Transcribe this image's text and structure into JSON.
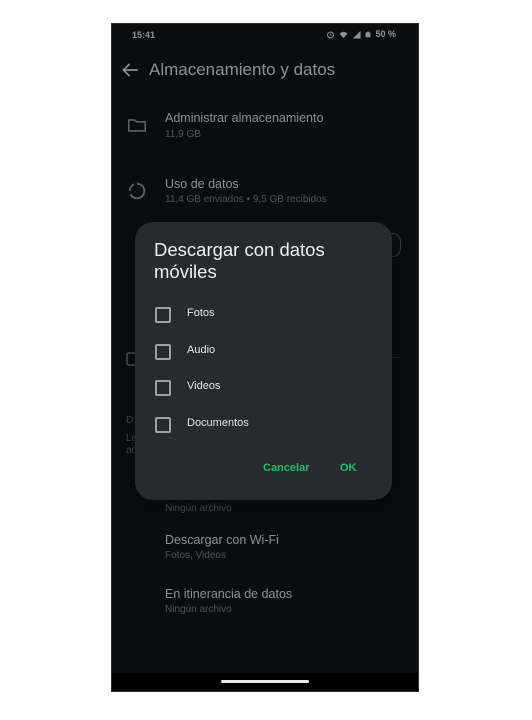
{
  "status_bar": {
    "time": "15:41",
    "battery": "50 %",
    "icons": [
      "alarm-icon",
      "wifi-icon",
      "signal-icon",
      "battery-icon"
    ]
  },
  "app_bar": {
    "title": "Almacenamiento y datos"
  },
  "settings": {
    "manage_storage": {
      "title": "Administrar almacenamiento",
      "subtitle": "11,9 GB"
    },
    "data_usage": {
      "title": "Uso de datos",
      "subtitle": "11,4 GB enviados • 9,5 GB recibidos"
    },
    "roaming_prev_sub": "Ningún archivo",
    "wifi": {
      "title": "Descargar con Wi-Fi",
      "subtitle": "Fotos, Videos"
    },
    "roaming": {
      "title": "En itinerancia de datos",
      "subtitle": "Ningún archivo"
    },
    "partial_letters": [
      "D",
      "Le",
      "ac"
    ]
  },
  "dialog": {
    "title": "Descargar con datos móviles",
    "options": [
      {
        "label": "Fotos",
        "checked": false
      },
      {
        "label": "Audio",
        "checked": false
      },
      {
        "label": "Videos",
        "checked": false
      },
      {
        "label": "Documentos",
        "checked": false
      }
    ],
    "cancel_label": "Cancelar",
    "ok_label": "OK"
  },
  "colors": {
    "background": "#111519",
    "dialog": "#262b30",
    "accent": "#21c063",
    "text_primary": "#e3e6e8",
    "text_secondary": "#7f878e"
  }
}
